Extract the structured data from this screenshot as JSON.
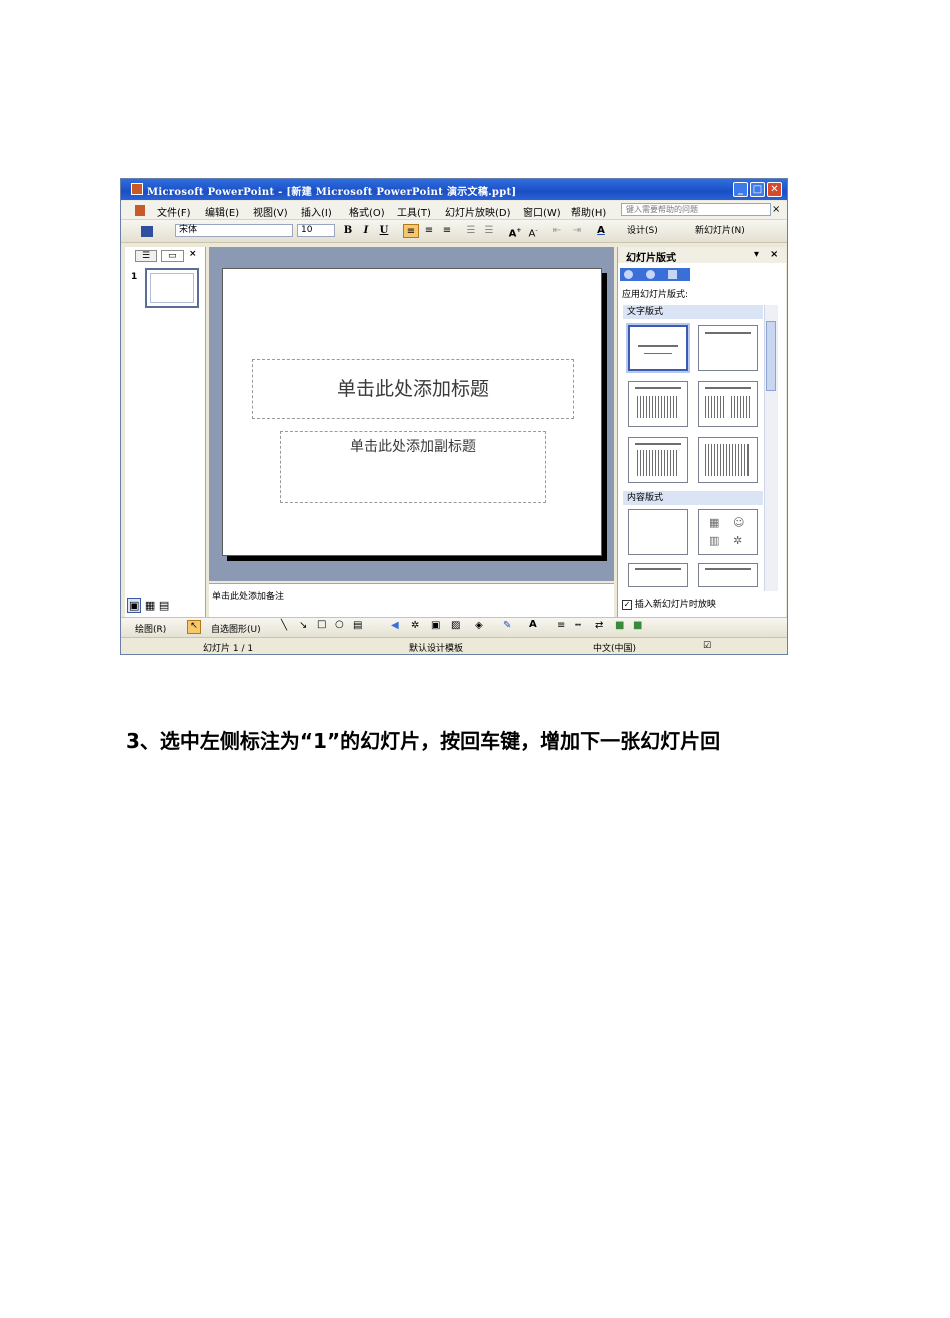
{
  "window": {
    "title": "Microsoft PowerPoint - [新建 Microsoft PowerPoint 演示文稿.ppt]",
    "min_symbol": "_",
    "max_symbol": "□",
    "close_symbol": "✕"
  },
  "menubar": {
    "items": [
      "文件(F)",
      "编辑(E)",
      "视图(V)",
      "插入(I)",
      "格式(O)",
      "工具(T)",
      "幻灯片放映(D)",
      "窗口(W)",
      "帮助(H)"
    ],
    "help_placeholder": "键入需要帮助的问题",
    "close_doc": "×"
  },
  "toolbar": {
    "font_name": "宋体",
    "font_size": "10",
    "bold": "B",
    "italic": "I",
    "underline": "U",
    "design_label": "设计(S)",
    "new_slide_label": "新幻灯片(N)"
  },
  "slides_pane": {
    "slide_number": "1",
    "close": "×"
  },
  "slide": {
    "title_placeholder": "单击此处添加标题",
    "subtitle_placeholder": "单击此处添加副标题"
  },
  "notes": {
    "placeholder": "单击此处添加备注"
  },
  "task_pane": {
    "title": "幻灯片版式",
    "subtitle": "应用幻灯片版式:",
    "group_text": "文字版式",
    "group_content": "内容版式",
    "show_on_insert": "插入新幻灯片时放映",
    "close": "×"
  },
  "drawbar": {
    "draw_label": "绘图(R)",
    "autoshapes_label": "自选图形(U)"
  },
  "statusbar": {
    "slide_count": "幻灯片 1 / 1",
    "template": "默认设计模板",
    "language": "中文(中国)"
  },
  "instruction": {
    "text": "3、选中左侧标注为“1”的幻灯片，按回车键，增加下一张幻灯片回"
  },
  "colors": {
    "titlebar": "#1b4fc4",
    "workspace": "#8c99b3",
    "selected_button": "#f7c76e"
  }
}
